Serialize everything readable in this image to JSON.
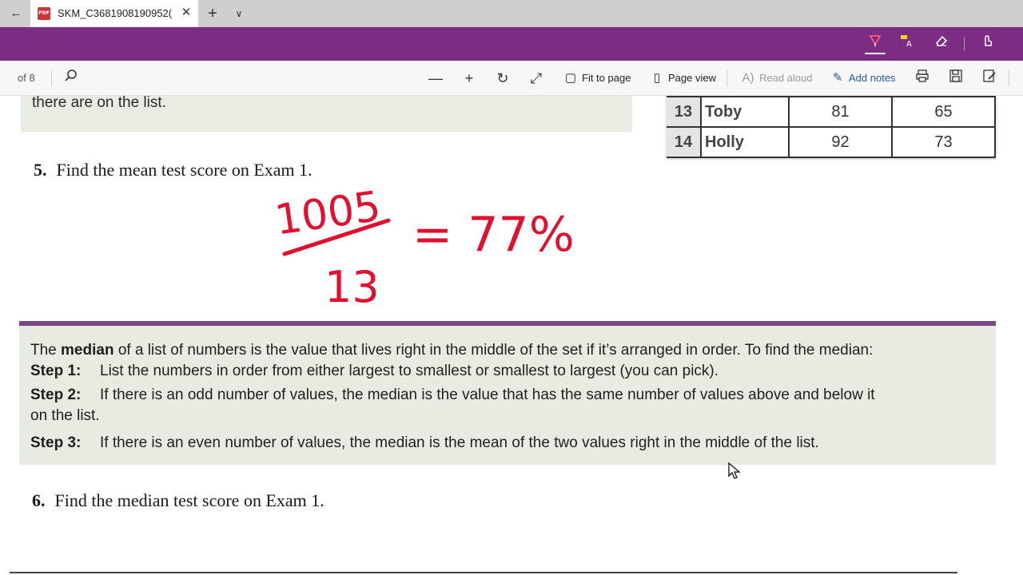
{
  "tabbar": {
    "tab_title": "SKM_C3681908190952(",
    "pdf_label": "PDF"
  },
  "inkbar": {
    "tools": [
      "pen-icon",
      "highlighter-icon",
      "eraser-icon",
      "touch-writing-icon"
    ]
  },
  "toolbar": {
    "page_of": "of 8",
    "fit_label": "Fit to page",
    "page_view_label": "Page view",
    "read_aloud_label": "Read aloud",
    "add_notes_label": "Add notes"
  },
  "document": {
    "top_box_text": "there are on the list.",
    "table_rows": [
      {
        "num": "13",
        "name": "Toby",
        "exam1": "81",
        "exam2": "65"
      },
      {
        "num": "14",
        "name": "Holly",
        "exam1": "92",
        "exam2": "73"
      }
    ],
    "q5": {
      "num": "5.",
      "text": "Find the mean test score on Exam 1."
    },
    "handwriting": {
      "numerator": "1005",
      "denominator": "13",
      "result": "= 77%"
    },
    "median_box": {
      "intro_pre": "The ",
      "intro_bold": "median",
      "intro_post": " of a list of numbers is the value that lives right in the middle of the set if it’s arranged in order. To find the median:",
      "step1_label": "Step 1:",
      "step1_text": "List the numbers in order from either largest to smallest or smallest to largest (you can pick).",
      "step2_label": "Step 2:",
      "step2_text": "If there is an odd number of values, the median is the value that has the same number of values above and below it",
      "step2_cont": "on the list.",
      "step3_label": "Step 3:",
      "step3_text": "If there is an even number of values, the median is the mean of the two values right in the middle of the list."
    },
    "q6": {
      "num": "6.",
      "text": "Find the median test score on Exam 1."
    }
  },
  "colors": {
    "ink_bar": "#7a2d83",
    "ink_red": "#e0102e",
    "accent_blue": "#2b5aa6",
    "median_rule": "#7b4a86"
  }
}
